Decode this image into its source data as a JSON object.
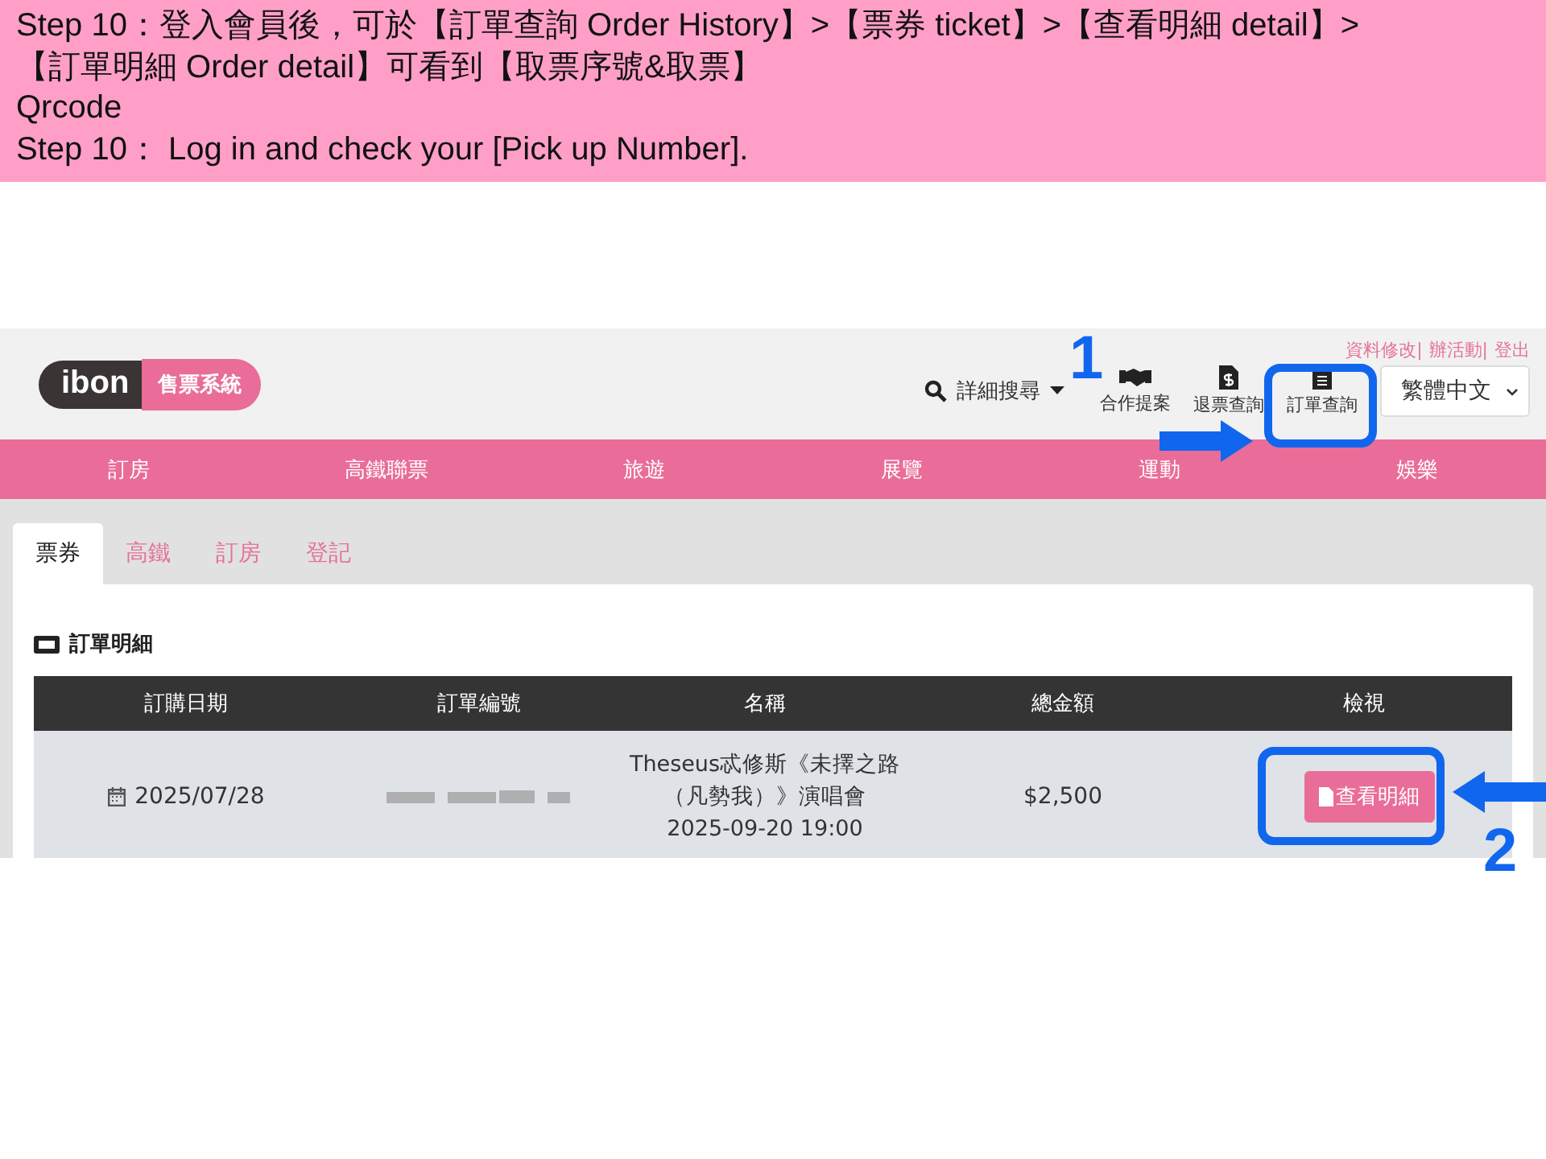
{
  "caption": {
    "lines": [
      "Step 10：登入會員後，可於【訂單查詢 Order History】>【票券 ticket】>【查看明細 detail】>",
      "【訂單明細 Order detail】可看到【取票序號&取票】",
      "Qrcode",
      "Step 10： Log in and check  your [Pick up Number]."
    ]
  },
  "header": {
    "logo": {
      "brand": "ibon",
      "label": "售票系統"
    },
    "search": "詳細搜尋",
    "top_links": [
      "資料修改|",
      "辦活動|",
      "登出"
    ],
    "tools": [
      {
        "kind": "handshake",
        "label": "合作提案"
      },
      {
        "kind": "refund",
        "label": "退票查詢"
      },
      {
        "kind": "order",
        "label": "訂單查詢"
      }
    ],
    "language": "繁體中文"
  },
  "nav": [
    "訂房",
    "高鐵聯票",
    "旅遊",
    "展覽",
    "運動",
    "娛樂"
  ],
  "tabs": [
    {
      "label": "票券",
      "selected": true
    },
    {
      "label": "高鐵",
      "selected": false
    },
    {
      "label": "訂房",
      "selected": false
    },
    {
      "label": "登記",
      "selected": false
    }
  ],
  "card": {
    "title": "訂單明細",
    "columns": [
      "訂購日期",
      "訂單編號",
      "名稱",
      "總金額",
      "檢視"
    ],
    "rows": [
      {
        "date": "2025/07/28",
        "name": "Theseus忒修斯《未擇之路（凡勢我）》演唱會",
        "time": "2025-09-20  19:00",
        "total": "$2,500",
        "action": "查看明細"
      }
    ]
  },
  "annotations": [
    {
      "kind": "step",
      "number": "1"
    },
    {
      "kind": "step",
      "number": "2"
    }
  ]
}
